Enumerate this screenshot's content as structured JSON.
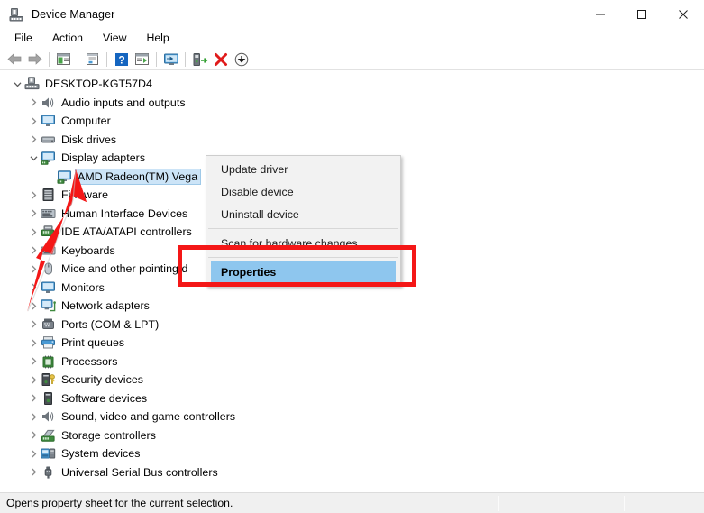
{
  "window": {
    "title": "Device Manager",
    "icon": "device-manager-icon",
    "controls": [
      {
        "name": "minimize-button",
        "glyph": "minimize"
      },
      {
        "name": "maximize-button",
        "glyph": "maximize"
      },
      {
        "name": "close-button",
        "glyph": "close"
      }
    ]
  },
  "menubar": {
    "items": [
      {
        "label": "File"
      },
      {
        "label": "Action"
      },
      {
        "label": "View"
      },
      {
        "label": "Help"
      }
    ]
  },
  "toolbar": {
    "buttons": [
      {
        "name": "back-icon",
        "type": "arrow-left-gray"
      },
      {
        "name": "forward-icon",
        "type": "arrow-right-gray"
      },
      {
        "name": "separator",
        "type": "sep"
      },
      {
        "name": "show-hide-console-tree-icon",
        "type": "panel-green"
      },
      {
        "name": "separator",
        "type": "sep"
      },
      {
        "name": "properties-icon",
        "type": "properties-page"
      },
      {
        "name": "separator",
        "type": "sep"
      },
      {
        "name": "help-icon",
        "type": "help-blue"
      },
      {
        "name": "view-icon",
        "type": "panel-play"
      },
      {
        "name": "separator",
        "type": "sep"
      },
      {
        "name": "update-driver-icon",
        "type": "monitor-blue"
      },
      {
        "name": "separator",
        "type": "sep"
      },
      {
        "name": "scan-for-hardware-changes-icon",
        "type": "scan-green"
      },
      {
        "name": "uninstall-device-icon",
        "type": "red-x"
      },
      {
        "name": "disable-device-icon",
        "type": "down-arrow-circle"
      }
    ]
  },
  "tree": {
    "root": {
      "label": "DESKTOP-KGT57D4",
      "icon": "computer-root-icon",
      "expanded": true,
      "indent": 0
    },
    "items": [
      {
        "label": "Audio inputs and outputs",
        "icon": "speaker-icon",
        "indent": 1,
        "expanded": false,
        "selected": false
      },
      {
        "label": "Computer",
        "icon": "monitor-icon",
        "indent": 1,
        "expanded": false,
        "selected": false
      },
      {
        "label": "Disk drives",
        "icon": "disk-drive-icon",
        "indent": 1,
        "expanded": false,
        "selected": false
      },
      {
        "label": "Display adapters",
        "icon": "display-adapter-icon",
        "indent": 1,
        "expanded": true,
        "selected": false
      },
      {
        "label": "AMD Radeon(TM) Vega",
        "icon": "display-adapter-icon",
        "indent": 2,
        "expanded": null,
        "selected": true
      },
      {
        "label": "Firmware",
        "icon": "firmware-icon",
        "indent": 1,
        "expanded": false,
        "selected": false
      },
      {
        "label": "Human Interface Devices",
        "icon": "hid-icon",
        "indent": 1,
        "expanded": false,
        "selected": false
      },
      {
        "label": "IDE ATA/ATAPI controllers",
        "icon": "ide-controller-icon",
        "indent": 1,
        "expanded": false,
        "selected": false
      },
      {
        "label": "Keyboards",
        "icon": "keyboard-icon",
        "indent": 1,
        "expanded": false,
        "selected": false
      },
      {
        "label": "Mice and other pointing d",
        "icon": "mouse-icon",
        "indent": 1,
        "expanded": false,
        "selected": false
      },
      {
        "label": "Monitors",
        "icon": "monitor-icon",
        "indent": 1,
        "expanded": false,
        "selected": false
      },
      {
        "label": "Network adapters",
        "icon": "network-adapter-icon",
        "indent": 1,
        "expanded": false,
        "selected": false
      },
      {
        "label": "Ports (COM & LPT)",
        "icon": "port-icon",
        "indent": 1,
        "expanded": false,
        "selected": false
      },
      {
        "label": "Print queues",
        "icon": "printer-icon",
        "indent": 1,
        "expanded": false,
        "selected": false
      },
      {
        "label": "Processors",
        "icon": "processor-icon",
        "indent": 1,
        "expanded": false,
        "selected": false
      },
      {
        "label": "Security devices",
        "icon": "security-device-icon",
        "indent": 1,
        "expanded": false,
        "selected": false
      },
      {
        "label": "Software devices",
        "icon": "software-device-icon",
        "indent": 1,
        "expanded": false,
        "selected": false
      },
      {
        "label": "Sound, video and game controllers",
        "icon": "speaker-icon",
        "indent": 1,
        "expanded": false,
        "selected": false
      },
      {
        "label": "Storage controllers",
        "icon": "storage-controller-icon",
        "indent": 1,
        "expanded": false,
        "selected": false
      },
      {
        "label": "System devices",
        "icon": "system-device-icon",
        "indent": 1,
        "expanded": false,
        "selected": false
      },
      {
        "label": "Universal Serial Bus controllers",
        "icon": "usb-icon",
        "indent": 1,
        "expanded": false,
        "selected": false
      }
    ]
  },
  "context_menu": {
    "items": [
      {
        "label": "Update driver",
        "highlighted": false,
        "separator_after": false
      },
      {
        "label": "Disable device",
        "highlighted": false,
        "separator_after": false
      },
      {
        "label": "Uninstall device",
        "highlighted": false,
        "separator_after": true
      },
      {
        "label": "Scan for hardware changes",
        "highlighted": false,
        "separator_after": true
      },
      {
        "label": "Properties",
        "highlighted": true,
        "separator_after": false
      }
    ]
  },
  "annotations": {
    "highlight_rect": {
      "name": "properties-highlight-rectangle",
      "color": "#f41717"
    },
    "arrow": {
      "name": "pointer-arrow",
      "color": "#f41717",
      "points_to": "AMD Radeon(TM) Vega"
    }
  },
  "statusbar": {
    "text": "Opens property sheet for the current selection."
  },
  "colors": {
    "selection_blue": "#cce4f7",
    "menu_highlight_blue": "#8ec6ee",
    "annotation_red": "#f41717",
    "chrome_gray": "#f0f0f0"
  }
}
